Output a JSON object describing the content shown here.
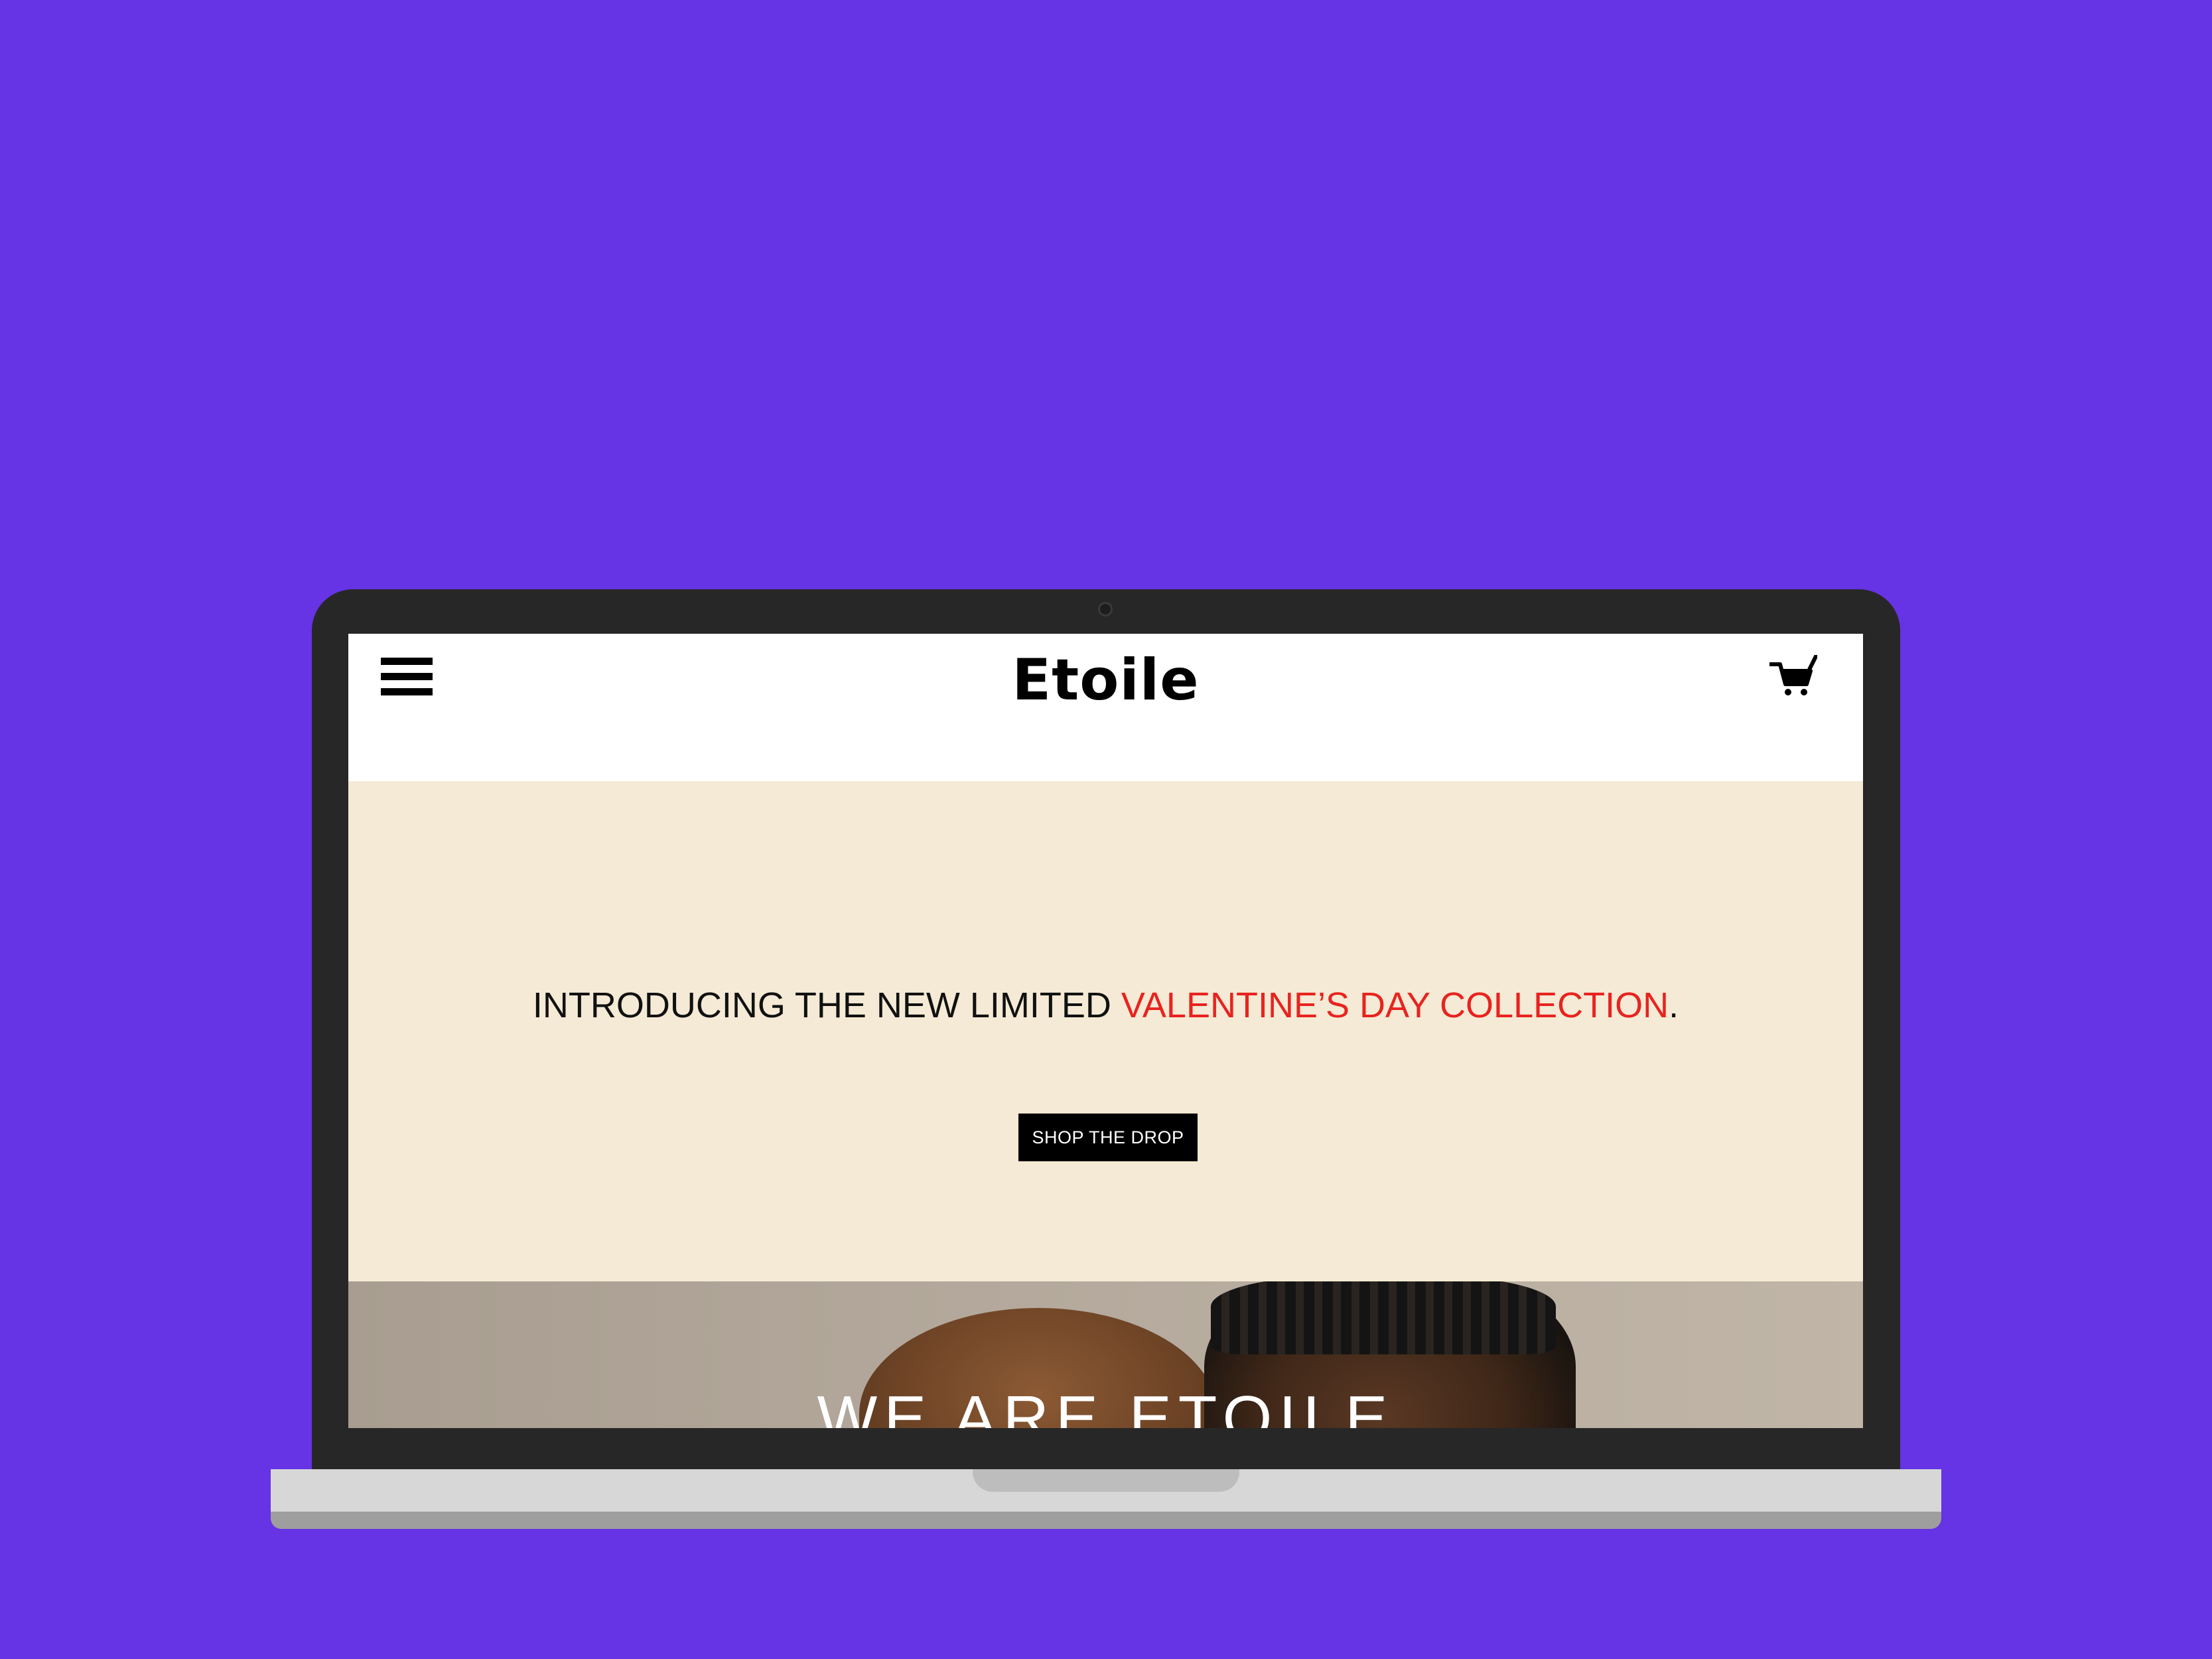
{
  "header": {
    "brand": "Etoile",
    "menu_icon": "hamburger-menu-icon",
    "cart_icon": "shopping-cart-icon"
  },
  "hero": {
    "headline_prefix": "INTRODUCING THE NEW LIMITED ",
    "headline_accent": "VALENTINE’S DAY COLLECTION",
    "headline_suffix": ".",
    "cta_label": "SHOP THE DROP"
  },
  "photo_section": {
    "overlay_text": "WE ARE ETOILE"
  },
  "colors": {
    "background": "#6633E5",
    "hero_background": "#F5EAD5",
    "accent": "#E8231F",
    "button": "#000000"
  }
}
